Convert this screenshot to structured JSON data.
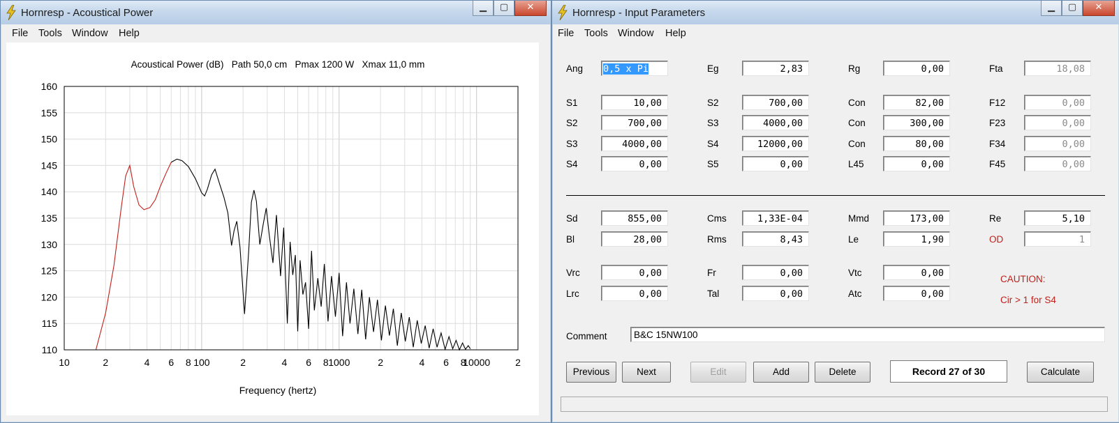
{
  "left_window": {
    "title": "Hornresp - Acoustical Power",
    "menu": [
      "File",
      "Tools",
      "Window",
      "Help"
    ],
    "chart_header": "Acoustical Power (dB)   Path 50,0 cm   Pmax 1200 W   Xmax 11,0 mm"
  },
  "right_window": {
    "title": "Hornresp - Input Parameters",
    "menu": [
      "File",
      "Tools",
      "Window",
      "Help"
    ],
    "rows_top": [
      [
        {
          "label": "Ang",
          "value": "0,5 x Pi",
          "selected": true
        },
        {
          "label": "Eg",
          "value": "2,83"
        },
        {
          "label": "Rg",
          "value": "0,00"
        },
        {
          "label": "Fta",
          "value": "18,08",
          "disabled": true
        }
      ],
      [
        {
          "label": "S1",
          "value": "10,00"
        },
        {
          "label": "S2",
          "value": "700,00"
        },
        {
          "label": "Con",
          "value": "82,00"
        },
        {
          "label": "F12",
          "value": "0,00",
          "disabled": true
        }
      ],
      [
        {
          "label": "S2",
          "value": "700,00"
        },
        {
          "label": "S3",
          "value": "4000,00"
        },
        {
          "label": "Con",
          "value": "300,00"
        },
        {
          "label": "F23",
          "value": "0,00",
          "disabled": true
        }
      ],
      [
        {
          "label": "S3",
          "value": "4000,00"
        },
        {
          "label": "S4",
          "value": "12000,00"
        },
        {
          "label": "Con",
          "value": "80,00"
        },
        {
          "label": "F34",
          "value": "0,00",
          "disabled": true
        }
      ],
      [
        {
          "label": "S4",
          "value": "0,00"
        },
        {
          "label": "S5",
          "value": "0,00"
        },
        {
          "label": "L45",
          "value": "0,00"
        },
        {
          "label": "F45",
          "value": "0,00",
          "disabled": true
        }
      ]
    ],
    "rows_driver": [
      [
        {
          "label": "Sd",
          "value": "855,00"
        },
        {
          "label": "Cms",
          "value": "1,33E-04"
        },
        {
          "label": "Mmd",
          "value": "173,00"
        },
        {
          "label": "Re",
          "value": "5,10"
        }
      ],
      [
        {
          "label": "Bl",
          "value": "28,00"
        },
        {
          "label": "Rms",
          "value": "8,43"
        },
        {
          "label": "Le",
          "value": "1,90"
        },
        {
          "label": "OD",
          "value": "1",
          "disabled": true,
          "red": true
        }
      ]
    ],
    "rows_chamber": [
      [
        {
          "label": "Vrc",
          "value": "0,00"
        },
        {
          "label": "Fr",
          "value": "0,00"
        },
        {
          "label": "Vtc",
          "value": "0,00"
        }
      ],
      [
        {
          "label": "Lrc",
          "value": "0,00"
        },
        {
          "label": "Tal",
          "value": "0,00"
        },
        {
          "label": "Atc",
          "value": "0,00"
        }
      ]
    ],
    "caution_title": "CAUTION:",
    "caution_text": "Cir > 1 for S4",
    "comment_label": "Comment",
    "comment_value": "B&C 15NW100",
    "buttons": {
      "previous": "Previous",
      "next": "Next",
      "edit": "Edit",
      "add": "Add",
      "delete": "Delete",
      "record": "Record 27 of 30",
      "calculate": "Calculate"
    }
  },
  "chart_data": {
    "type": "line",
    "title": "Acoustical Power (dB)   Path 50,0 cm   Pmax 1200 W   Xmax 11,0 mm",
    "xlabel": "Frequency (hertz)",
    "ylabel": "",
    "xscale": "log",
    "xlim": [
      10,
      20000
    ],
    "ylim": [
      110,
      160
    ],
    "yticks": [
      110,
      115,
      120,
      125,
      130,
      135,
      140,
      145,
      150,
      155,
      160
    ],
    "xtick_labels": [
      "10",
      "2",
      "4",
      "6",
      "8",
      "100",
      "2",
      "4",
      "6",
      "8",
      "1000",
      "2",
      "4",
      "6",
      "8",
      "10000",
      "2"
    ],
    "grid": true,
    "series": [
      {
        "color": "#c0201a",
        "x": [
          17,
          20,
          23,
          26,
          28,
          30,
          32,
          35,
          38,
          42,
          46,
          50,
          55,
          60
        ],
        "y": [
          110,
          117,
          126,
          137,
          143,
          145,
          141,
          137.5,
          136.6,
          137,
          138.5,
          141,
          143.5,
          145.6
        ]
      },
      {
        "color": "#000000",
        "x": [
          60,
          66,
          72,
          80,
          90,
          100,
          105,
          110,
          118,
          125,
          135,
          145,
          155,
          165,
          172,
          180,
          190,
          205,
          220,
          230,
          240,
          250,
          265,
          280,
          295,
          310,
          330,
          350,
          375,
          395,
          420,
          440,
          460,
          480,
          500,
          520,
          545,
          570,
          600,
          630,
          660,
          700,
          740,
          780,
          830,
          880,
          940,
          1000,
          1060,
          1130,
          1200,
          1280,
          1370,
          1460,
          1560,
          1660,
          1780,
          1900,
          2030,
          2170,
          2320,
          2480,
          2650,
          2830,
          3030,
          3240,
          3460,
          3700,
          3960,
          4230,
          4520,
          4830,
          5160,
          5520,
          5900,
          6300,
          6700,
          7100,
          7500,
          7900,
          8300,
          8700,
          9000
        ],
        "y": [
          145.6,
          146.2,
          145.9,
          144.8,
          142.5,
          139.8,
          139.2,
          140.5,
          143.2,
          144.3,
          141.5,
          139.0,
          136.0,
          129.8,
          132.6,
          134.4,
          129.5,
          116.8,
          128.8,
          138.0,
          140.3,
          138.2,
          130.0,
          133.8,
          136.9,
          131.8,
          126.5,
          135.6,
          124.0,
          133.2,
          115.0,
          130.5,
          124.2,
          128.0,
          113.5,
          127.0,
          120.5,
          122.8,
          114.0,
          128.8,
          117.5,
          123.6,
          118.2,
          126.3,
          115.4,
          124.0,
          116.3,
          124.6,
          112.6,
          122.8,
          115.0,
          121.6,
          113.0,
          121.4,
          112.0,
          120.0,
          113.4,
          119.5,
          111.8,
          118.4,
          112.7,
          117.8,
          110.8,
          117.0,
          111.6,
          116.2,
          110.5,
          115.6,
          111.2,
          114.6,
          110.3,
          114.0,
          110.5,
          113.2,
          110.1,
          112.5,
          110.2,
          111.8,
          110.0,
          111.3,
          110.1,
          110.8,
          110.2
        ]
      }
    ]
  }
}
